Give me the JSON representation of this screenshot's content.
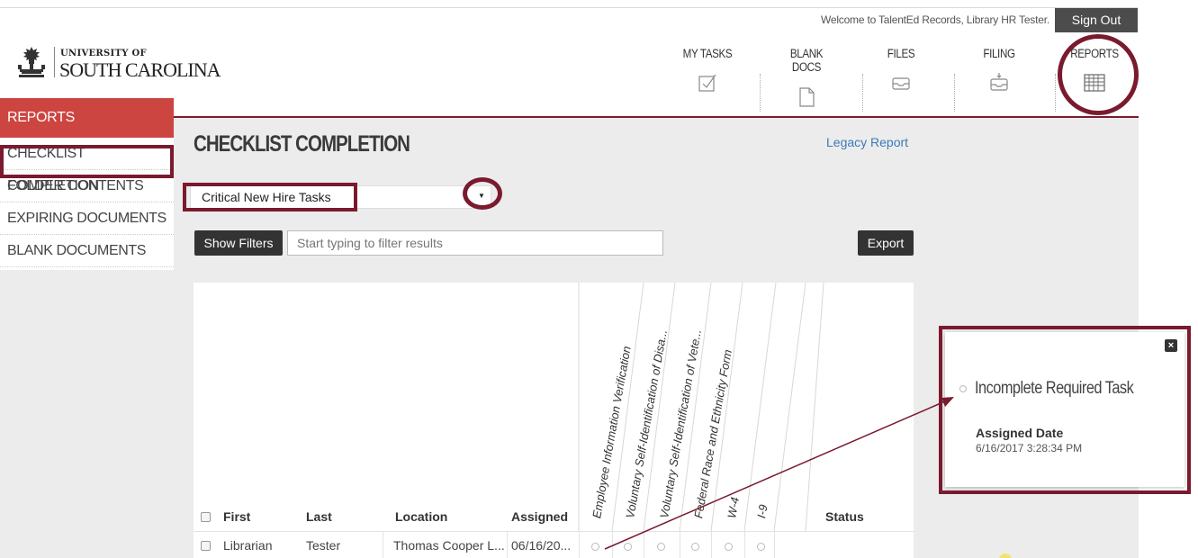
{
  "topbar": {
    "welcome": "Welcome to TalentEd Records, Library HR Tester.",
    "sign_out": "Sign Out"
  },
  "logo": {
    "line1": "UNIVERSITY OF",
    "line2": "SOUTH CAROLINA"
  },
  "nav": {
    "items": [
      {
        "label": "MY TASKS",
        "icon": "checkbox-icon"
      },
      {
        "label": "BLANK DOCS",
        "icon": "document-icon"
      },
      {
        "label": "FILES",
        "icon": "inbox-icon"
      },
      {
        "label": "FILING",
        "icon": "filing-tray-icon"
      },
      {
        "label": "REPORTS",
        "icon": "table-grid-icon"
      }
    ]
  },
  "sidebar": {
    "header": "REPORTS",
    "items": [
      {
        "label": "CHECKLIST COMPLETION",
        "active": true
      },
      {
        "label": "FOLDER CONTENTS"
      },
      {
        "label": "EXPIRING DOCUMENTS"
      },
      {
        "label": "BLANK DOCUMENTS"
      }
    ]
  },
  "main": {
    "title": "CHECKLIST COMPLETION",
    "legacy_link": "Legacy Report",
    "checklist_selected": "Critical New Hire Tasks",
    "show_filters": "Show Filters",
    "filter_placeholder": "Start typing to filter results",
    "export": "Export"
  },
  "table": {
    "task_columns": [
      "Employee Information Verification",
      "Voluntary Self-Identification of Disa...",
      "Voluntary Self-Identification of Vete...",
      "Federal Race and Ethnicity Form",
      "W-4",
      "I-9"
    ],
    "headers": {
      "first": "First",
      "last": "Last",
      "location": "Location",
      "assigned": "Assigned",
      "status": "Status"
    },
    "rows": [
      {
        "first": "Librarian",
        "last": "Tester",
        "location": "Thomas Cooper L...",
        "assigned": "06/16/20...",
        "tasks": [
          "incomplete",
          "incomplete",
          "incomplete",
          "incomplete",
          "incomplete",
          "incomplete"
        ],
        "status": ""
      }
    ]
  },
  "popup": {
    "close": "×",
    "status": "Incomplete Required Task",
    "assigned_label": "Assigned Date",
    "assigned_value": "6/16/2017 3:28:34 PM"
  },
  "colors": {
    "accent_maroon": "#7a1a2e",
    "sidebar_header": "#cd4540",
    "link_blue": "#3c7ab8",
    "button_dark": "#333333",
    "content_bg": "#ececec"
  }
}
